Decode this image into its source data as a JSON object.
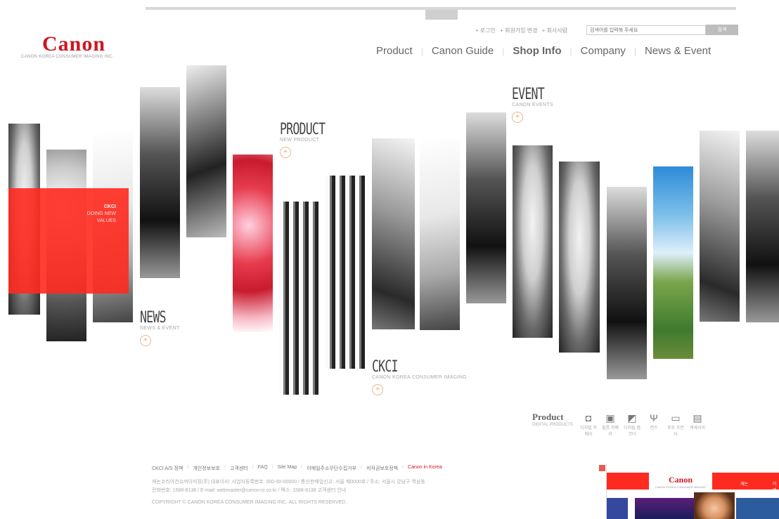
{
  "top_tab": "",
  "logo": {
    "word": "Canon",
    "sub": "CANON KOREA CONSUMER IMAGING INC."
  },
  "util_links": [
    "+ 로그인",
    "+ 회원가입 변경",
    "+ 회사사람"
  ],
  "search": {
    "placeholder": "검색어를 입력해 주세요",
    "button": "검색"
  },
  "gnb": [
    {
      "label": "Product",
      "bold": false
    },
    {
      "label": "Canon Guide",
      "bold": false
    },
    {
      "label": "Shop Info",
      "bold": true
    },
    {
      "label": "Company",
      "bold": false
    },
    {
      "label": "News & Event",
      "bold": false
    }
  ],
  "red_block_text": [
    "CKCI",
    "DOING NEW",
    "VALUES"
  ],
  "sections": {
    "product": {
      "title": "PRODUCT",
      "sub": "NEW PRODUCT"
    },
    "event": {
      "title": "EVENT",
      "sub": "CANON EVENTS"
    },
    "news": {
      "title": "NEWS",
      "sub": "NEWS & EVENT"
    },
    "ckci": {
      "title": "CKCI",
      "sub": "CANON KOREA CONSUMER IMAGING"
    }
  },
  "product_bar": {
    "title": "Product",
    "sub": "DIGITAL PRODUCTS",
    "items": [
      {
        "icon": "◘",
        "label": "디지털 카메라"
      },
      {
        "icon": "▣",
        "label": "필름 카메라"
      },
      {
        "icon": "◩",
        "label": "디지털 캠코더"
      },
      {
        "icon": "Ψ",
        "label": "렌즈"
      },
      {
        "icon": "▭",
        "label": "포토 프린터"
      },
      {
        "icon": "▤",
        "label": "액세서리"
      }
    ]
  },
  "footer": {
    "links": [
      "CKCI A/S 정책",
      "개인정보보호",
      "고객센터",
      "FAQ",
      "Site Map",
      "이메일주소무단수집거부",
      "저작권보호정책",
      "Canon in Korea"
    ],
    "line1": "캐논코리아컨슈머이미징(주) 대표이사: 사업자등록번호: 000-00-00000 / 통신판매업신고: 서울 제0000호 / 주소: 서울시 강남구 역삼동",
    "line2": "전화번호: 1588-8138 / E-mail: webmaster@canon-ci.co.kr / 팩스: 1588-8138 고객센터 안내",
    "line3": "COPYRIGHT © CANON KOREA CONSUMER IMAGING INC. ALL RIGHTS RESERVED."
  },
  "popup": {
    "logo": "Canon",
    "logo_sub": "CANON KOREA CONSUMER IMAGING",
    "tab1": "캐논",
    "tab2": "이벤",
    "divider_text": "···"
  }
}
